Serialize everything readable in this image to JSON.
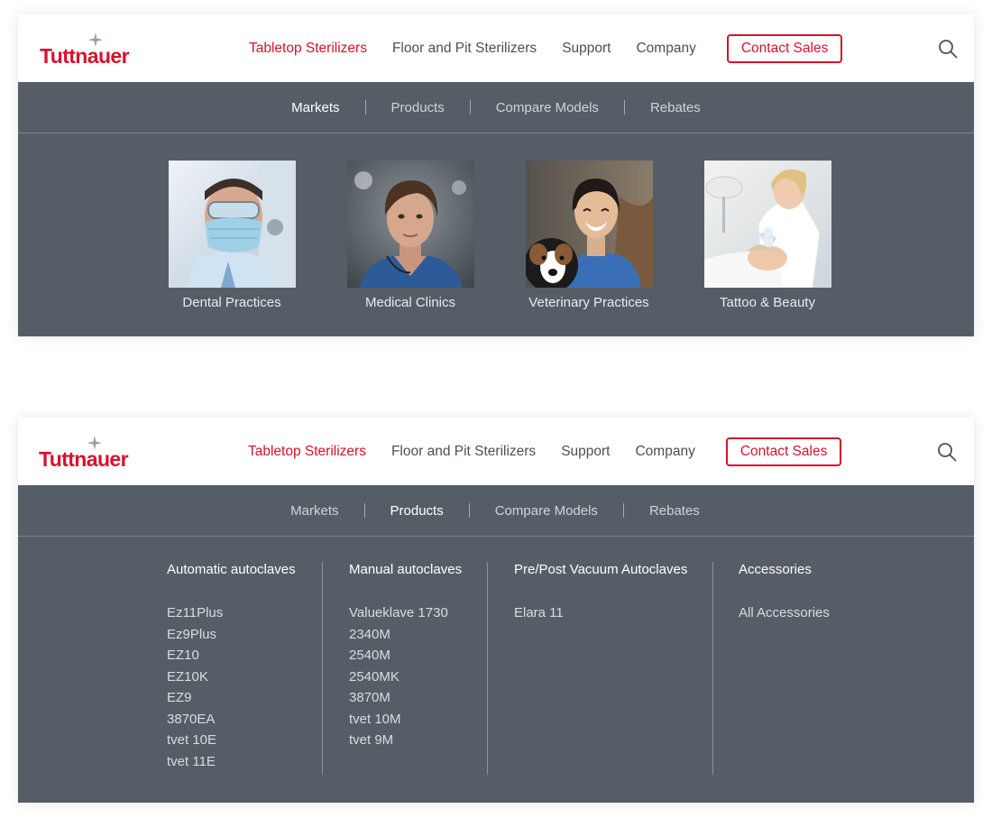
{
  "brand": {
    "logo_text": "Tuttnauer",
    "accent": "#d7122d",
    "nav_bg": "#555e67"
  },
  "header": {
    "nav": [
      "Tabletop Sterilizers",
      "Floor and Pit Sterilizers",
      "Support",
      "Company"
    ],
    "contact_label": "Contact Sales",
    "search_icon": "search-icon"
  },
  "subnav": [
    "Markets",
    "Products",
    "Compare Models",
    "Rebates"
  ],
  "markets": [
    {
      "label": "Dental Practices",
      "icon": "dental-photo"
    },
    {
      "label": "Medical Clinics",
      "icon": "medical-photo"
    },
    {
      "label": "Veterinary Practices",
      "icon": "veterinary-photo"
    },
    {
      "label": "Tattoo & Beauty",
      "icon": "beauty-photo"
    }
  ],
  "products": {
    "columns": [
      {
        "heading": "Automatic autoclaves",
        "items": [
          "Ez11Plus",
          "Ez9Plus",
          "EZ10",
          "EZ10K",
          "EZ9",
          "3870EA",
          "tvet 10E",
          "tvet 11E"
        ]
      },
      {
        "heading": "Manual autoclaves",
        "items": [
          "Valueklave 1730",
          "2340M",
          "2540M",
          "2540MK",
          "3870M",
          "tvet 10M",
          "tvet 9M"
        ]
      },
      {
        "heading": "Pre/Post Vacuum Autoclaves",
        "items": [
          "Elara 11"
        ]
      },
      {
        "heading": "Accessories",
        "items": [
          "All Accessories"
        ]
      }
    ]
  }
}
